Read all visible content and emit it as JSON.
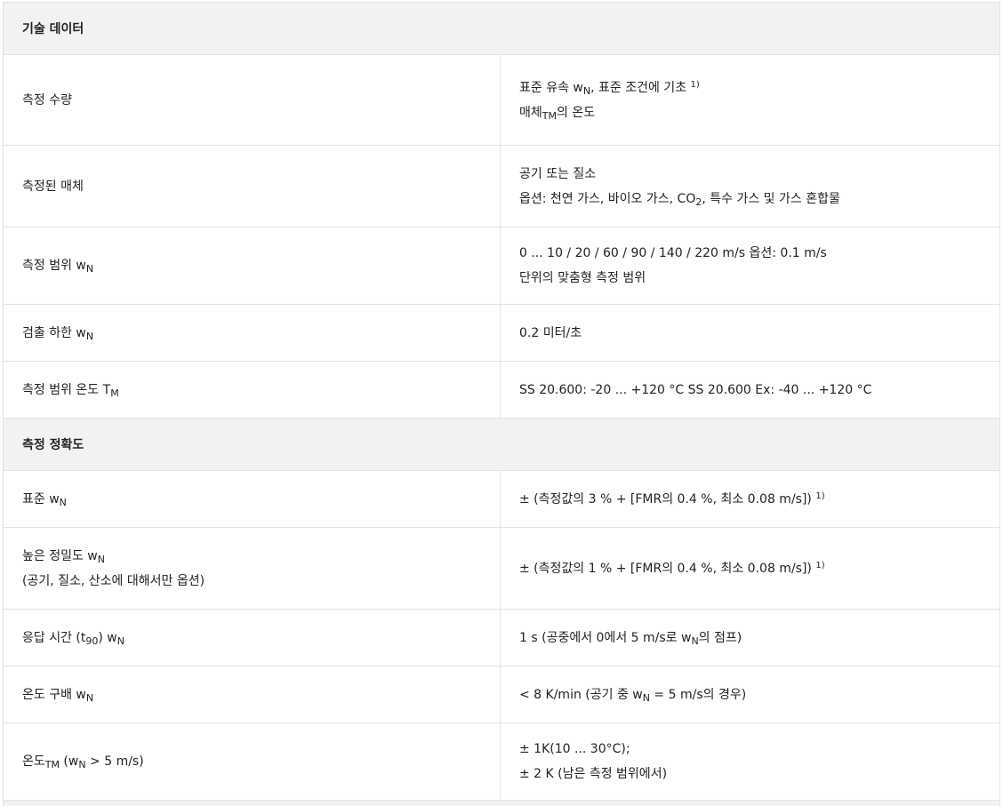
{
  "section1": {
    "title": "기술 데이터"
  },
  "rows1": [
    {
      "label": "측정 수량",
      "v1": "표준 유속 w",
      "v1_sub": "N",
      "v1_rest": ", 표준 조건에 기초 ",
      "v1_sup": "1)",
      "v2a": "매체",
      "v2_sub": "TM",
      "v2b": "의 온도"
    },
    {
      "label": "측정된 매체",
      "v1": "공기 또는 질소",
      "v2a": "옵션: 천연 가스, 바이오 가스, CO",
      "v2_sub": "2",
      "v2b": ", 특수 가스 및 가스 혼합물"
    },
    {
      "label": "측정 범위 w",
      "label_sub": "N",
      "v1": "0 ... 10 / 20 / 60 / 90 / 140 / 220 m/s 옵션: 0.1 m/s",
      "v2": "단위의 맞춤형 측정 범위"
    },
    {
      "label": "검출 하한 w",
      "label_sub": "N",
      "v1": "0.2 미터/초"
    },
    {
      "label": "측정 범위 온도 T",
      "label_sub": "M",
      "v1": "SS 20.600: -20 ... +120 °C SS 20.600 Ex: -40 ... +120 °C"
    }
  ],
  "section2": {
    "title": "측정 정확도"
  },
  "rows2": [
    {
      "label": "표준 w",
      "label_sub": "N",
      "v1": "± (측정값의 3 % + [FMR의 0.4 %, 최소 0.08 m/s]) ",
      "v1_sup": "1)"
    },
    {
      "label": "높은 정밀도 w",
      "label_sub": "N",
      "label2": "(공기, 질소, 산소에 대해서만 옵션)",
      "v1": "± (측정값의 1 % + [FMR의 0.4 %, 최소 0.08 m/s]) ",
      "v1_sup": "1)"
    },
    {
      "label_a": "응답 시간 (t",
      "label_sub": "90",
      "label_b": ") w",
      "label_sub2": "N",
      "v1a": "1 s (공중에서 0에서 5 m/s로 w",
      "v1_sub": "N",
      "v1b": "의 점프)"
    },
    {
      "label": "온도 구배 w",
      "label_sub": "N",
      "v1a": "< 8 K/min (공기 중 w",
      "v1_sub": "N",
      "v1b": " = 5 m/s의 경우)"
    },
    {
      "label_a": "온도",
      "label_sub": "TM",
      "label_b": " (w",
      "label_sub2": "N",
      "label_c": " > 5 m/s)",
      "v1": "± 1K(10 ... 30°C);",
      "v2": "± 2 K (남은 측정 범위에서)"
    }
  ]
}
